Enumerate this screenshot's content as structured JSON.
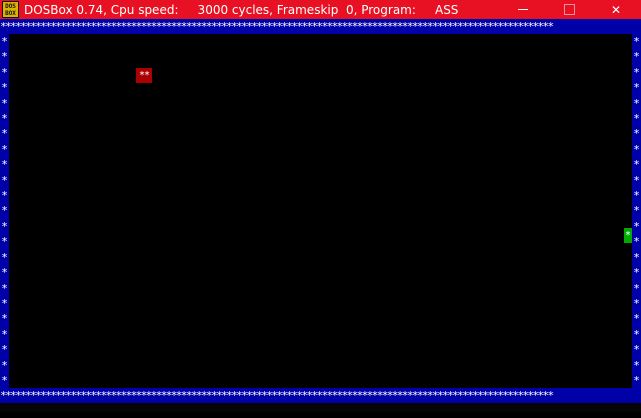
{
  "window": {
    "title": "DOSBox 0.74, Cpu speed:     3000 cycles, Frameskip  0, Program:     ASS",
    "icon_top": "DOS",
    "icon_bottom": "BOX",
    "title_bar_color": "#e81123",
    "controls": {
      "minimize_icon": "minimize-icon",
      "maximize_icon": "maximize-icon",
      "close_glyph": "✕"
    }
  },
  "game": {
    "wall_char": "*",
    "wall_color": "#0000a8",
    "snake_text": "**",
    "snake_color": "#aa0000",
    "food_text": "*",
    "food_color": "#00aa00"
  }
}
